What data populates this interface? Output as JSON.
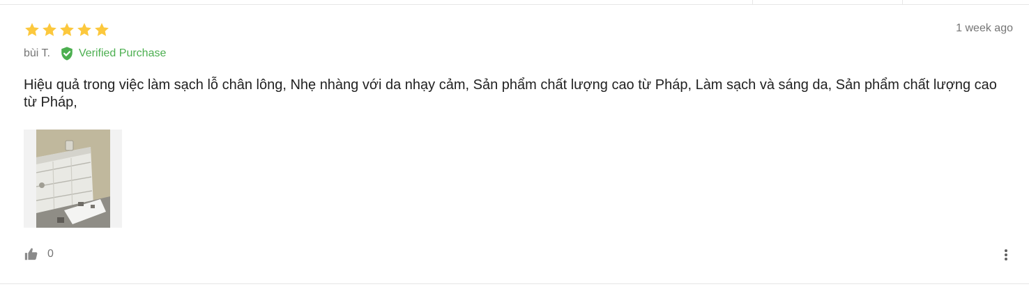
{
  "review": {
    "rating": 5,
    "max_rating": 5,
    "time_ago": "1 week ago",
    "author": "bùi T.",
    "verified_label": "Verified Purchase",
    "text": "Hiệu quả trong việc làm sạch lỗ chân lông, Nhẹ nhàng với da nhạy cảm, Sản phẩm chất lượng cao từ Pháp, Làm sạch và sáng da, Sản phẩm chất lượng cao từ Pháp,",
    "like_count": "0"
  },
  "colors": {
    "star": "#fcc83d",
    "verified": "#4caf50",
    "muted": "#757575",
    "text": "#212121"
  },
  "icons": {
    "star": "star-icon",
    "verified": "verified-check-icon",
    "like": "thumbs-up-icon",
    "more": "more-vertical-icon"
  }
}
